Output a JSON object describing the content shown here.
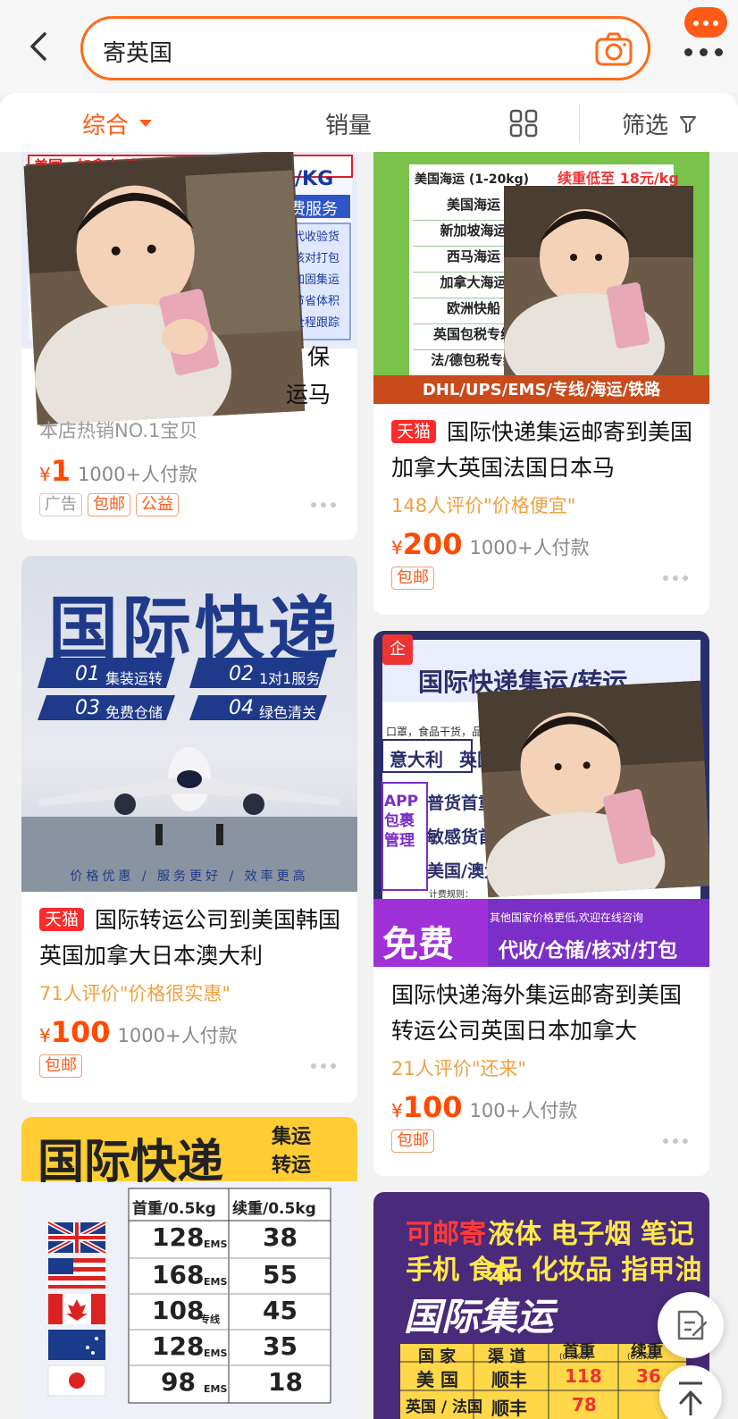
{
  "search": {
    "query": "寄英国"
  },
  "filters": {
    "comprehensive": "综合",
    "sales": "销量",
    "filter": "筛选"
  },
  "products": [
    {
      "image_text": {
        "line1": "美国，加拿大 澳洲",
        "line2": "/KG",
        "line3": "费服务",
        "items": [
          "代收验货",
          "核对打包",
          "加固集运",
          "节省体积",
          "全程跟踪"
        ]
      },
      "title_visible": [
        "保",
        "运马"
      ],
      "subtitle": "本店热销NO.1宝贝",
      "price": "1",
      "paid": "1000+人付款",
      "tags": [
        "广告",
        "包邮",
        "公益"
      ]
    },
    {
      "image_text": {
        "left_items": [
          "美国海运",
          "新加坡海运",
          "西马海运",
          "加拿大海运",
          "欧洲快船",
          "英国包税专线",
          "法/德包税专线"
        ],
        "top_header": "美国海运 (1-20kg)",
        "top_right": "续重低至 18元/kg",
        "bottom_banner": "DHL/UPS/EMS/专线/海运/铁路"
      },
      "badge": "天猫",
      "title": "国际快递集运邮寄到美国加拿大英国法国日本马",
      "review": "148人评价\"价格便宜\"",
      "price": "200",
      "paid": "1000+人付款",
      "tags": [
        "包邮"
      ]
    },
    {
      "image_text": {
        "headline": "国际快递",
        "features": [
          "集装运转",
          "1对1服务",
          "免费仓储",
          "绿色清关"
        ],
        "feature_nums": [
          "01",
          "02",
          "03",
          "04"
        ],
        "footer": "价格优惠 / 服务更好 / 效率更高"
      },
      "badge": "天猫",
      "title": "国际转运公司到美国韩国英国加拿大日本澳大利",
      "review": "71人评价\"价格很实惠\"",
      "price": "100",
      "paid": "1000+人付款",
      "tags": [
        "包邮"
      ]
    },
    {
      "image_text": {
        "badge": "企",
        "headline": "国际快递集运/转运",
        "sub": "口罩，食品干货，品牌，",
        "countries": [
          "意大利",
          "英国"
        ],
        "side": "APP包裹管理",
        "rows": [
          "普货首重",
          "敏感货首重",
          "美国/澳大"
        ],
        "small": "计费规则：",
        "notice": "其他国家价格更低,欢迎在线咨询",
        "free": "免费",
        "services": "代收/仓储/核对/打包"
      },
      "title": "国际快递海外集运邮寄到美国转运公司英国日本加拿大",
      "review": "21人评价\"还来\"",
      "price": "100",
      "paid": "100+人付款",
      "tags": [
        "包邮"
      ]
    },
    {
      "image_text": {
        "headline": "国际快递",
        "side": [
          "集运",
          "转运"
        ],
        "headers": [
          "首重/0.5kg",
          "续重/0.5kg"
        ],
        "rows": [
          [
            "128",
            "EMS",
            "38"
          ],
          [
            "168",
            "EMS",
            "55"
          ],
          [
            "108",
            "专线",
            "45"
          ],
          [
            "128",
            "EMS",
            "35"
          ],
          [
            "98",
            "EMS",
            "18"
          ]
        ]
      }
    },
    {
      "image_text": {
        "line1_red": "可邮寄",
        "line1": "液体 电子烟 笔记本",
        "line2": "手机 食品 化妆品 指甲油",
        "headline": "国际集运",
        "table_headers": [
          "国 家",
          "渠 道",
          "首重",
          "续重"
        ],
        "table_sub": [
          "(0.5KG)",
          "(0.5KG)"
        ],
        "rows": [
          [
            "美 国",
            "顺丰",
            "118",
            "36"
          ],
          [
            "英国 / 法国",
            "顺丰",
            "78",
            ""
          ]
        ]
      }
    }
  ],
  "currency": "¥"
}
